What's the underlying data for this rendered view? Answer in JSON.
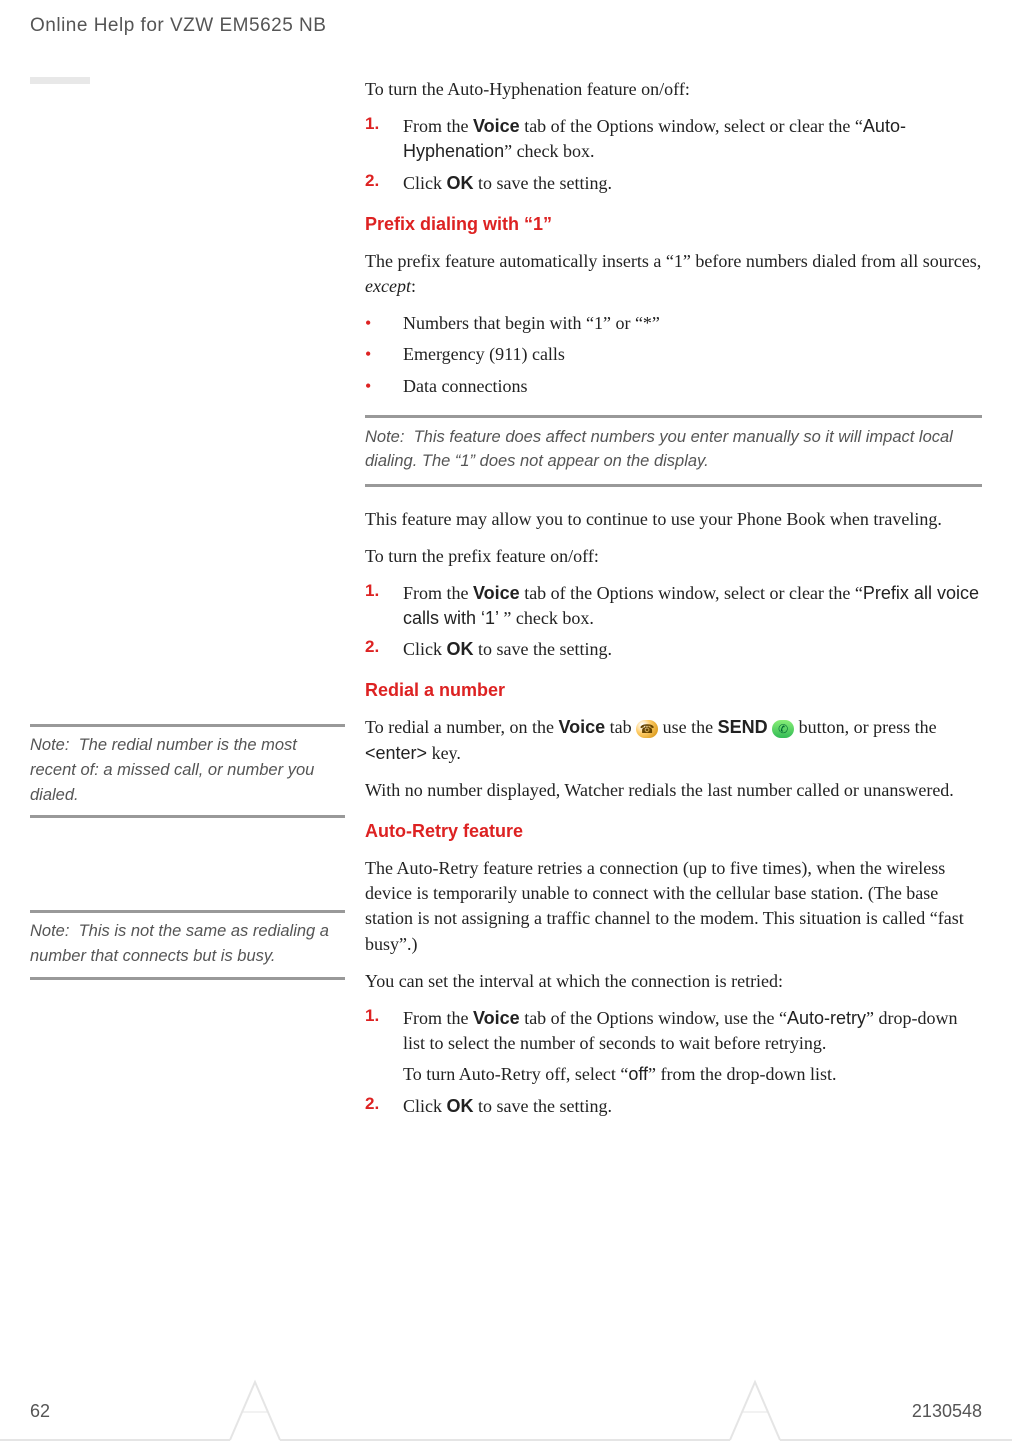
{
  "header": "Online Help for VZW EM5625 NB",
  "footer": {
    "page_number": "62",
    "doc_id": "2130548"
  },
  "colors": {
    "accent": "#d22",
    "rule": "#999"
  },
  "section1": {
    "intro": "To turn the Auto-Hyphenation feature on/off:",
    "step1_pre": "From the ",
    "step1_voice": "Voice",
    "step1_mid": " tab of the Options window, select or clear the “",
    "step1_opt": "Auto-Hyphenation",
    "step1_post": "” check box.",
    "step2_pre": "Click ",
    "step2_ok": "OK",
    "step2_post": " to save the setting."
  },
  "prefix": {
    "heading": "Prefix dialing with “1”",
    "p1_pre": "The prefix feature automatically inserts a “1” before numbers dialed from all sources, ",
    "p1_it": "except",
    "p1_post": ":",
    "b1": "Numbers that begin with “1” or “*”",
    "b2": "Emergency (911) calls",
    "b3": "Data connections",
    "note": "Note:  This feature does affect numbers you enter manually so it will impact local dialing. The “1” does not appear on the display.",
    "p2": "This feature may allow you to continue to use your Phone Book when traveling.",
    "p3": "To turn the prefix feature on/off:",
    "step1_pre": "From the ",
    "step1_voice": "Voice",
    "step1_mid": " tab of the Options window, select or clear the “",
    "step1_opt": "Prefix all voice calls with ‘1’ ",
    "step1_post": "” check box.",
    "step2_pre": "Click ",
    "step2_ok": "OK",
    "step2_post": " to save the setting."
  },
  "redial": {
    "heading": "Redial a number",
    "side_note": "Note:  The redial number is the most recent of: a missed call, or number you dialed.",
    "p1_pre": "To redial a number, on the ",
    "p1_voice": "Voice",
    "p1_mid": " tab ",
    "p1_mid2": " use the ",
    "p1_send": "SEND",
    "p1_mid3": " button, or press the ",
    "p1_enter": "<enter>",
    "p1_post": " key.",
    "p2": "With no number displayed, Watcher redials the last number called or unanswered."
  },
  "autoretry": {
    "heading": "Auto-Retry feature",
    "side_note": "Note:  This is not the same as redialing a number that connects but is busy.",
    "p1": "The Auto-Retry feature retries a connection (up to five times), when the wireless device is temporarily unable to connect with the cellular base station. (The base station is not assigning a traffic channel to the modem. This situation is called “fast busy”.)",
    "p2": "You can set the interval at which the connection is retried:",
    "step1_pre": "From the ",
    "step1_voice": "Voice",
    "step1_mid": " tab of the Options window, use the “",
    "step1_opt": "Auto-retry",
    "step1_post": "” drop-down list to select the number of seconds to wait before retrying.",
    "step1_sub_pre": "To turn Auto-Retry off, select “",
    "step1_sub_opt": "off",
    "step1_sub_post": "” from the drop-down list.",
    "step2_pre": "Click ",
    "step2_ok": "OK",
    "step2_post": " to save the setting."
  },
  "icons": {
    "voice_glyph": "☎",
    "send_glyph": "✆"
  }
}
